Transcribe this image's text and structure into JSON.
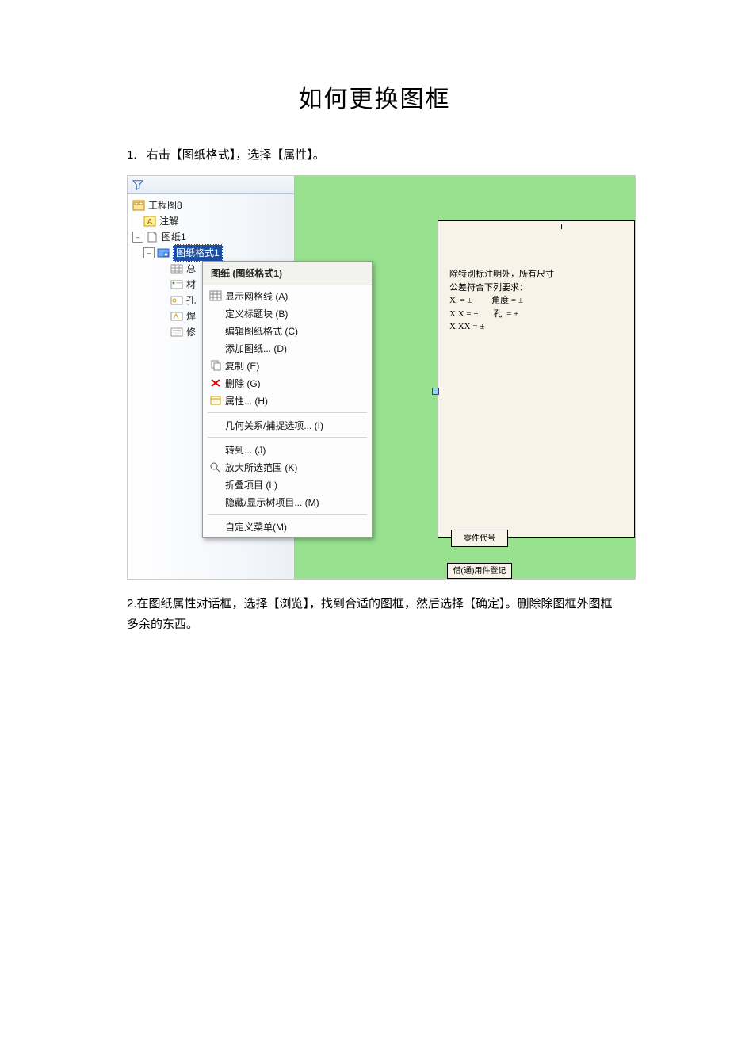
{
  "doc": {
    "title": "如何更换图框",
    "step1_num": "1.",
    "step1_text": "右击【图纸格式】，选择【属性】。",
    "step2_text": "2.在图纸属性对话框，选择【浏览】，找到合适的图框，然后选择【确定】。删除除图框外图框多余的东西。"
  },
  "tree": {
    "root": "工程图8",
    "annotations": "注解",
    "sheet": "图纸1",
    "format_selected": "图纸格式1",
    "items": [
      "总",
      "材",
      "孔",
      "焊",
      "修"
    ]
  },
  "context_menu": {
    "title": "图纸 (图纸格式1)",
    "items": [
      {
        "label": "显示网格线 (A)",
        "icon": "grid"
      },
      {
        "label": "定义标题块 (B)"
      },
      {
        "label": "编辑图纸格式 (C)"
      },
      {
        "label": "添加图纸... (D)"
      },
      {
        "label": "复制 (E)",
        "icon": "copy"
      },
      {
        "label": "删除 (G)",
        "icon": "delete"
      },
      {
        "label": "属性... (H)",
        "icon": "props"
      }
    ],
    "group2": [
      {
        "label": "几何关系/捕捉选项... (I)"
      }
    ],
    "group3": [
      {
        "label": "转到... (J)"
      },
      {
        "label": "放大所选范围 (K)",
        "icon": "zoom"
      },
      {
        "label": "折叠项目 (L)"
      },
      {
        "label": "隐藏/显示树项目... (M)"
      }
    ],
    "group4": [
      {
        "label": "自定义菜单(M)"
      }
    ]
  },
  "sheet_note": {
    "line1": "除特别标注明外，所有尺寸",
    "line2": "公差符合下列要求：",
    "line3a": "X. = ±",
    "line3b": "角度 = ±",
    "line4a": "X.X = ±",
    "line4b": "孔. = ±",
    "line5": "X.XX = ±"
  },
  "sheet_blocks": {
    "block1": "零件代号",
    "block2": "借(通)用件登记"
  }
}
